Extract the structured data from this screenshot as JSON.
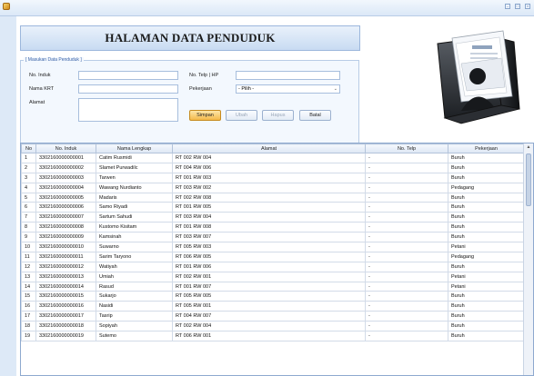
{
  "title": "HALAMAN DATA PENDUDUK",
  "form": {
    "legend": "[ Masukan Data Penduduk ]",
    "fields": {
      "no_induk": {
        "label": "No. Induk",
        "value": ""
      },
      "nama_krt": {
        "label": "Nama KRT",
        "value": ""
      },
      "alamat": {
        "label": "Alamat",
        "value": ""
      },
      "no_telp": {
        "label": "No. Telp | HP",
        "value": ""
      },
      "pekerjaan": {
        "label": "Pekerjaan",
        "selected": "- Pilih -"
      }
    },
    "buttons": {
      "simpan": "Simpan",
      "ubah": "Ubah",
      "hapus": "Hapus",
      "batal": "Batal"
    }
  },
  "icons": {
    "app": "app-icon",
    "illustration": "user-documents-illustration"
  },
  "colors": {
    "accent": "#c8dbf2",
    "active_button": "#f4b94a"
  },
  "table": {
    "columns": [
      "No",
      "No. Induk",
      "Nama Lengkap",
      "Alamat",
      "No. Telp",
      "Pekerjaan"
    ],
    "rows": [
      [
        "1",
        "3302160000000001",
        "Catim Rusmidi",
        "RT 002 RW 004",
        "-",
        "Buruh"
      ],
      [
        "2",
        "3302160000000002",
        "Slamet Purwadilc",
        "RT 004 RW 006",
        "-",
        "Buruh"
      ],
      [
        "3",
        "3302160000000003",
        "Tarwen",
        "RT 001 RW 003",
        "-",
        "Buruh"
      ],
      [
        "4",
        "3302160000000004",
        "Wawang Nurdianto",
        "RT 003 RW 002",
        "-",
        "Pedagang"
      ],
      [
        "5",
        "3302160000000005",
        "Madaris",
        "RT 002 RW 008",
        "-",
        "Buruh"
      ],
      [
        "6",
        "3302160000000006",
        "Samo Riyadi",
        "RT 001 RW 005",
        "-",
        "Buruh"
      ],
      [
        "7",
        "3302160000000007",
        "Sartum Sahudi",
        "RT 003 RW 004",
        "-",
        "Buruh"
      ],
      [
        "8",
        "3302160000000008",
        "Kustomo Kisitam",
        "RT 001 RW 008",
        "-",
        "Buruh"
      ],
      [
        "9",
        "3302160000000009",
        "Kamsinah",
        "RT 003 RW 007",
        "-",
        "Buruh"
      ],
      [
        "10",
        "3302160000000010",
        "Suwarno",
        "RT 005 RW 003",
        "-",
        "Petani"
      ],
      [
        "11",
        "3302160000000011",
        "Sarim Taryono",
        "RT 006 RW 005",
        "-",
        "Pedagang"
      ],
      [
        "12",
        "3302160000000012",
        "Watiyah",
        "RT 001 RW 006",
        "-",
        "Buruh"
      ],
      [
        "13",
        "3302160000000013",
        "Umiah",
        "RT 002 RW 001",
        "-",
        "Petani"
      ],
      [
        "14",
        "3302160000000014",
        "Rasud",
        "RT 001 RW 007",
        "-",
        "Petani"
      ],
      [
        "15",
        "3302160000000015",
        "Sukarjo",
        "RT 005 RW 005",
        "-",
        "Buruh"
      ],
      [
        "16",
        "3302160000000016",
        "Nasidi",
        "RT 005 RW 001",
        "-",
        "Buruh"
      ],
      [
        "17",
        "3302160000000017",
        "Tasrip",
        "RT 004 RW 007",
        "-",
        "Buruh"
      ],
      [
        "18",
        "3302160000000018",
        "Sopiyah",
        "RT 002 RW 004",
        "-",
        "Buruh"
      ],
      [
        "19",
        "3302160000000019",
        "Sutemo",
        "RT 006 RW 001",
        "-",
        "Buruh"
      ]
    ]
  }
}
